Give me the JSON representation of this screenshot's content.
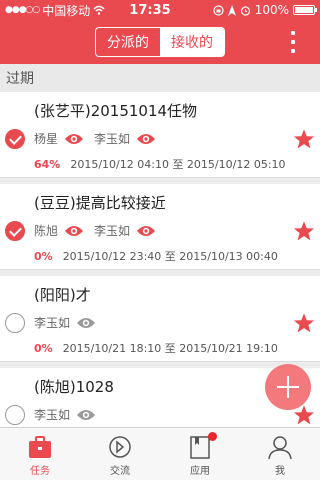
{
  "status_bar": {
    "carrier": "中国移动",
    "time": "17:35",
    "battery": "100%"
  },
  "nav": {
    "tabs": [
      {
        "label": "分派的",
        "active": false
      },
      {
        "label": "接收的",
        "active": true
      }
    ],
    "more_icon": "more-vertical-icon"
  },
  "section": {
    "title": "过期"
  },
  "tasks": [
    {
      "title": "(张艺平)20151014任物",
      "done": true,
      "people": [
        "杨星",
        "李玉如"
      ],
      "progress": "64%",
      "time_range": "2015/10/12 04:10 至 2015/10/12 05:10",
      "starred": true
    },
    {
      "title": "(豆豆)提高比较接近",
      "done": true,
      "people": [
        "陈旭",
        "李玉如"
      ],
      "progress": "0%",
      "time_range": "2015/10/12 23:40 至 2015/10/13 00:40",
      "starred": true
    },
    {
      "title": "(阳阳)才",
      "done": false,
      "people": [
        "李玉如"
      ],
      "progress": "0%",
      "time_range": "2015/10/21 18:10 至 2015/10/21 19:10",
      "starred": true
    },
    {
      "title": "(陈旭)1028",
      "done": false,
      "people": [
        "李玉如"
      ],
      "progress": "",
      "time_range": "",
      "starred": true
    }
  ],
  "tab_bar": [
    {
      "label": "任务",
      "icon": "briefcase-icon",
      "active": true
    },
    {
      "label": "交流",
      "icon": "compass-icon",
      "active": false
    },
    {
      "label": "应用",
      "icon": "book-icon",
      "active": false,
      "badge": true
    },
    {
      "label": "我",
      "icon": "person-icon",
      "active": false
    }
  ],
  "colors": {
    "accent": "#e84a4f",
    "background": "#ececec"
  }
}
